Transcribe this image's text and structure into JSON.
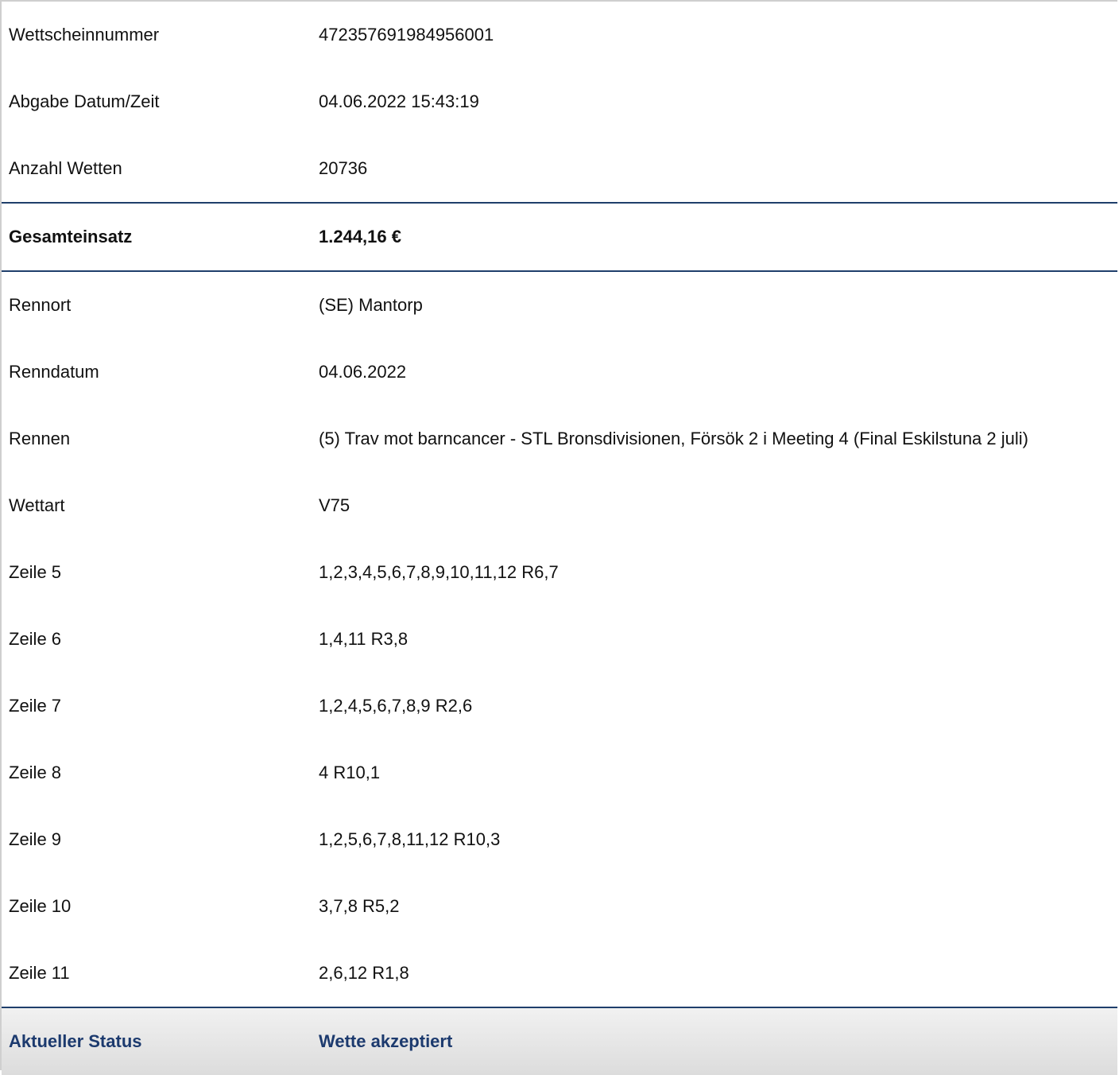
{
  "ticket_info": [
    {
      "label": "Wettscheinnummer",
      "value": "472357691984956001"
    },
    {
      "label": "Abgabe Datum/Zeit",
      "value": "04.06.2022 15:43:19"
    },
    {
      "label": "Anzahl Wetten",
      "value": "20736"
    }
  ],
  "total": {
    "label": "Gesamteinsatz",
    "value": "1.244,16 €"
  },
  "race_info": [
    {
      "label": "Rennort",
      "value": "(SE) Mantorp"
    },
    {
      "label": "Renndatum",
      "value": "04.06.2022"
    },
    {
      "label": "Rennen",
      "value": "(5) Trav mot barncancer - STL Bronsdivisionen, Försök 2 i Meeting 4 (Final Eskilstuna 2 juli)"
    },
    {
      "label": "Wettart",
      "value": "V75"
    },
    {
      "label": "Zeile 5",
      "value": "1,2,3,4,5,6,7,8,9,10,11,12 R6,7"
    },
    {
      "label": "Zeile 6",
      "value": "1,4,11 R3,8"
    },
    {
      "label": "Zeile 7",
      "value": "1,2,4,5,6,7,8,9 R2,6"
    },
    {
      "label": "Zeile 8",
      "value": "4 R10,1"
    },
    {
      "label": "Zeile 9",
      "value": "1,2,5,6,7,8,11,12 R10,3"
    },
    {
      "label": "Zeile 10",
      "value": "3,7,8 R5,2"
    },
    {
      "label": "Zeile 11",
      "value": "2,6,12 R1,8"
    }
  ],
  "status": {
    "label": "Aktueller Status",
    "value": "Wette akzeptiert"
  },
  "colors": {
    "divider": "#1f3f6b",
    "status_text": "#1c3a6e",
    "status_background": "#e4e4e4"
  }
}
